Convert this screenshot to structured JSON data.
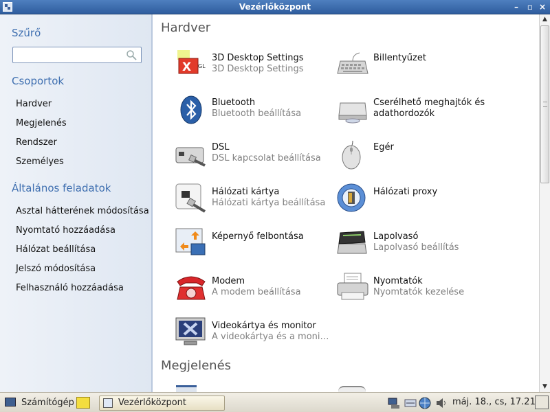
{
  "window": {
    "title": "Vezérlőközpont"
  },
  "sidebar": {
    "filter_heading": "Szűrő",
    "search": {
      "value": "",
      "placeholder": ""
    },
    "groups_heading": "Csoportok",
    "groups": [
      "Hardver",
      "Megjelenés",
      "Rendszer",
      "Személyes"
    ],
    "tasks_heading": "Általános feladatok",
    "tasks": [
      "Asztal hátterének módosítása",
      "Nyomtató hozzáadása",
      "Hálózat beállítása",
      "Jelszó módosítása",
      "Felhasználó hozzáadása"
    ]
  },
  "main": {
    "groups": [
      {
        "title": "Hardver",
        "items": [
          {
            "name": "3D Desktop Settings",
            "desc": "3D Desktop Settings",
            "icon": "3d-desktop-icon"
          },
          {
            "name": "Billentyűzet",
            "desc": "",
            "icon": "keyboard-icon"
          },
          {
            "name": "Bluetooth",
            "desc": "Bluetooth beállítása",
            "icon": "bluetooth-icon"
          },
          {
            "name": "Cserélhető meghajtók és adathordozók",
            "desc": "",
            "icon": "removable-drive-icon"
          },
          {
            "name": "DSL",
            "desc": "DSL kapcsolat beállítása",
            "icon": "dsl-modem-icon"
          },
          {
            "name": "Egér",
            "desc": "",
            "icon": "mouse-icon"
          },
          {
            "name": "Hálózati kártya",
            "desc": "Hálózati kártya beállítása",
            "icon": "network-card-icon"
          },
          {
            "name": "Hálózati proxy",
            "desc": "",
            "icon": "network-proxy-icon"
          },
          {
            "name": "Képernyő felbontása",
            "desc": "",
            "icon": "screen-resolution-icon"
          },
          {
            "name": "Lapolvasó",
            "desc": "Lapolvasó beállítás",
            "icon": "scanner-icon"
          },
          {
            "name": "Modem",
            "desc": "A modem beállítása",
            "icon": "modem-phone-icon"
          },
          {
            "name": "Nyomtatók",
            "desc": "Nyomtatók kezelése",
            "icon": "printer-icon"
          },
          {
            "name": "Videokártya és monitor",
            "desc": "A videokártya és a moni…",
            "icon": "video-monitor-icon"
          }
        ]
      },
      {
        "title": "Megjelenés",
        "items": []
      }
    ]
  },
  "taskbar": {
    "computer_label": "Számítógép",
    "window_label": "Vezérlőközpont",
    "clock": "máj. 18., cs, 17.21"
  },
  "colors": {
    "accent": "#3f6fb0",
    "titlebar": "#3d6cae",
    "sidebar_bg": "#e6ecf5"
  }
}
